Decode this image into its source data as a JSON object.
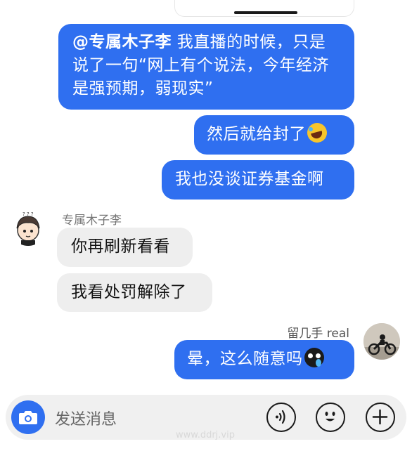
{
  "messages": [
    {
      "direction": "out",
      "mention": "@专属木子李",
      "text": " 我直播的时候，只是说了一句“网上有个说法，今年经济是强预期，弱现实”"
    },
    {
      "direction": "out",
      "text": "然后就给封了",
      "emoji": "rofl-emoji"
    },
    {
      "direction": "out",
      "text": "我也没谈证券基金啊"
    },
    {
      "direction": "in",
      "text": "你再刷新看看"
    },
    {
      "direction": "in",
      "text": "我看处罚解除了"
    },
    {
      "direction": "out",
      "text": "晕，这么随意吗",
      "emoji": "dizzy-face-emoji"
    }
  ],
  "senders": {
    "left_name": "专属木子李",
    "right_name": "留几手 real"
  },
  "input": {
    "placeholder": "发送消息"
  },
  "icons": {
    "camera": "camera-icon",
    "voice": "voice-icon",
    "emoji": "emoji-icon",
    "plus": "plus-icon"
  },
  "colors": {
    "outgoing_bubble": "#2f6ff0",
    "incoming_bubble": "#eeeeee",
    "input_bar": "#f0f0f0"
  },
  "watermark": "www.ddrj.vip"
}
